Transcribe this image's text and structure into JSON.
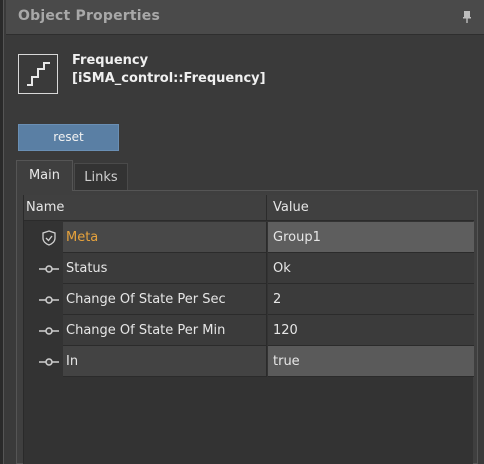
{
  "panel": {
    "title": "Object Properties",
    "pin_icon": "pin-icon"
  },
  "object": {
    "name": "Frequency",
    "type": "[iSMA_control::Frequency]",
    "icon": "frequency-block-icon"
  },
  "toolbar": {
    "reset_label": "reset"
  },
  "tabs": [
    {
      "label": "Main",
      "active": true
    },
    {
      "label": "Links",
      "active": false
    }
  ],
  "table": {
    "columns": {
      "name": "Name",
      "value": "Value"
    },
    "rows": [
      {
        "icon": "shield-icon",
        "name": "Meta",
        "value": "Group1"
      },
      {
        "icon": "slot-icon",
        "name": "Status",
        "value": "Ok"
      },
      {
        "icon": "slot-icon",
        "name": "Change Of State Per Sec",
        "value": "2"
      },
      {
        "icon": "slot-icon",
        "name": "Change Of State Per Min",
        "value": "120"
      },
      {
        "icon": "slot-icon",
        "name": "In",
        "value": "true"
      }
    ]
  },
  "colors": {
    "accent_button": "#5a7fa4",
    "meta_label": "#e6a23c",
    "background": "#3a3a3a"
  }
}
